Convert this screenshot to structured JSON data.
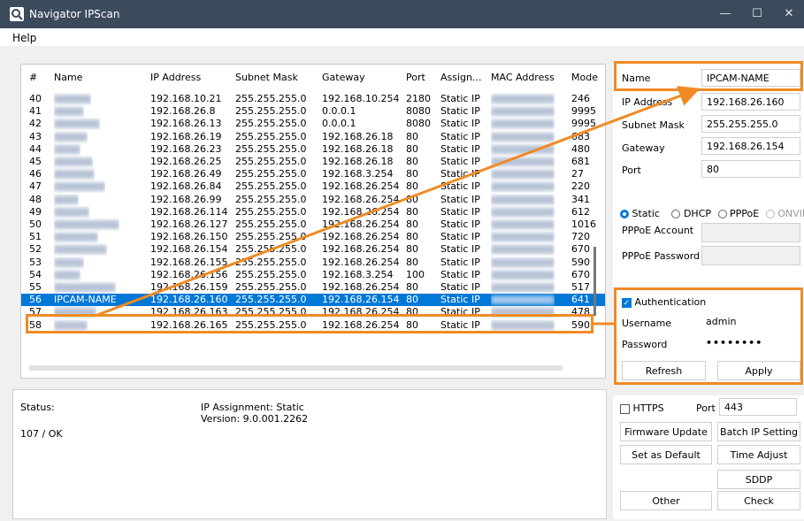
{
  "window": {
    "title": "Navigator IPScan",
    "minimize": "—",
    "maximize": "☐",
    "close": "✕"
  },
  "menu": {
    "help": "Help"
  },
  "table": {
    "headers": [
      "#",
      "Name",
      "IP Address",
      "Subnet Mask",
      "Gateway",
      "Port",
      "Assign...",
      "MAC Address",
      "Mode"
    ],
    "rows": [
      {
        "n": "40",
        "ip": "192.168.10.21",
        "mask": "255.255.255.0",
        "gw": "192.168.10.254",
        "port": "2180",
        "assign": "Static IP",
        "mode": "246"
      },
      {
        "n": "41",
        "ip": "192.168.26.8",
        "mask": "255.255.255.0",
        "gw": "0.0.0.1",
        "port": "8080",
        "assign": "Static IP",
        "mode": "9995"
      },
      {
        "n": "42",
        "ip": "192.168.26.13",
        "mask": "255.255.255.0",
        "gw": "0.0.0.1",
        "port": "8080",
        "assign": "Static IP",
        "mode": "9995"
      },
      {
        "n": "43",
        "ip": "192.168.26.19",
        "mask": "255.255.255.0",
        "gw": "192.168.26.18",
        "port": "80",
        "assign": "Static IP",
        "mode": "683"
      },
      {
        "n": "44",
        "ip": "192.168.26.23",
        "mask": "255.255.255.0",
        "gw": "192.168.26.18",
        "port": "80",
        "assign": "Static IP",
        "mode": "480"
      },
      {
        "n": "45",
        "ip": "192.168.26.25",
        "mask": "255.255.255.0",
        "gw": "192.168.26.18",
        "port": "80",
        "assign": "Static IP",
        "mode": "681"
      },
      {
        "n": "46",
        "ip": "192.168.26.49",
        "mask": "255.255.255.0",
        "gw": "192.168.3.254",
        "port": "80",
        "assign": "Static IP",
        "mode": "27"
      },
      {
        "n": "47",
        "ip": "192.168.26.84",
        "mask": "255.255.255.0",
        "gw": "192.168.26.254",
        "port": "80",
        "assign": "Static IP",
        "mode": "220"
      },
      {
        "n": "48",
        "ip": "192.168.26.99",
        "mask": "255.255.255.0",
        "gw": "192.168.26.254",
        "port": "80",
        "assign": "Static IP",
        "mode": "341"
      },
      {
        "n": "49",
        "ip": "192.168.26.114",
        "mask": "255.255.255.0",
        "gw": "192.168.26.254",
        "port": "80",
        "assign": "Static IP",
        "mode": "612"
      },
      {
        "n": "50",
        "ip": "192.168.26.127",
        "mask": "255.255.255.0",
        "gw": "192.168.26.254",
        "port": "80",
        "assign": "Static IP",
        "mode": "1016"
      },
      {
        "n": "51",
        "ip": "192.168.26.150",
        "mask": "255.255.255.0",
        "gw": "192.168.26.254",
        "port": "80",
        "assign": "Static IP",
        "mode": "720"
      },
      {
        "n": "52",
        "ip": "192.168.26.154",
        "mask": "255.255.255.0",
        "gw": "192.168.26.254",
        "port": "80",
        "assign": "Static IP",
        "mode": "670"
      },
      {
        "n": "53",
        "ip": "192.168.26.155",
        "mask": "255.255.255.0",
        "gw": "192.168.26.254",
        "port": "80",
        "assign": "Static IP",
        "mode": "590"
      },
      {
        "n": "54",
        "ip": "192.168.26.156",
        "mask": "255.255.255.0",
        "gw": "192.168.3.254",
        "port": "100",
        "assign": "Static IP",
        "mode": "670"
      },
      {
        "n": "55",
        "ip": "192.168.26.159",
        "mask": "255.255.255.0",
        "gw": "192.168.26.254",
        "port": "80",
        "assign": "Static IP",
        "mode": "517"
      },
      {
        "n": "56",
        "name": "IPCAM-NAME",
        "ip": "192.168.26.160",
        "mask": "255.255.255.0",
        "gw": "192.168.26.154",
        "port": "80",
        "assign": "Static IP",
        "mode": "641",
        "selected": true
      },
      {
        "n": "57",
        "ip": "192.168.26.163",
        "mask": "255.255.255.0",
        "gw": "192.168.26.254",
        "port": "80",
        "assign": "Static IP",
        "mode": "478"
      },
      {
        "n": "58",
        "ip": "192.168.26.165",
        "mask": "255.255.255.0",
        "gw": "192.168.26.254",
        "port": "80",
        "assign": "Static IP",
        "mode": "590"
      }
    ]
  },
  "status": {
    "label": "Status:",
    "value": "107 / OK",
    "assignment": "IP Assignment: Static",
    "version": "Version: 9.0.001.2262"
  },
  "settings": {
    "name_label": "Name",
    "name_value": "IPCAM-NAME",
    "ip_label": "IP Address",
    "ip_value": "192.168.26.160",
    "mask_label": "Subnet Mask",
    "mask_value": "255.255.255.0",
    "gateway_label": "Gateway",
    "gateway_value": "192.168.26.154",
    "port_label": "Port",
    "port_value": "80",
    "radio_static": "Static",
    "radio_dhcp": "DHCP",
    "radio_pppoe": "PPPoE",
    "radio_onvif": "ONVIF",
    "pppoe_account_label": "PPPoE Account",
    "pppoe_password_label": "PPPoE Password"
  },
  "auth": {
    "checkbox_label": "Authentication",
    "username_label": "Username",
    "username_value": "admin",
    "password_label": "Password",
    "password_value": "••••••••",
    "refresh": "Refresh",
    "apply": "Apply"
  },
  "actions": {
    "https_label": "HTTPS",
    "port_label": "Port",
    "port_value": "443",
    "firmware_update": "Firmware Update",
    "batch_ip": "Batch IP Setting",
    "set_default": "Set as Default",
    "time_adjust": "Time Adjust",
    "sddp": "SDDP",
    "other": "Other",
    "check": "Check"
  },
  "colors": {
    "accent": "#0078d7",
    "highlight": "#f08a24",
    "titlebar": "#3c4b5c"
  }
}
